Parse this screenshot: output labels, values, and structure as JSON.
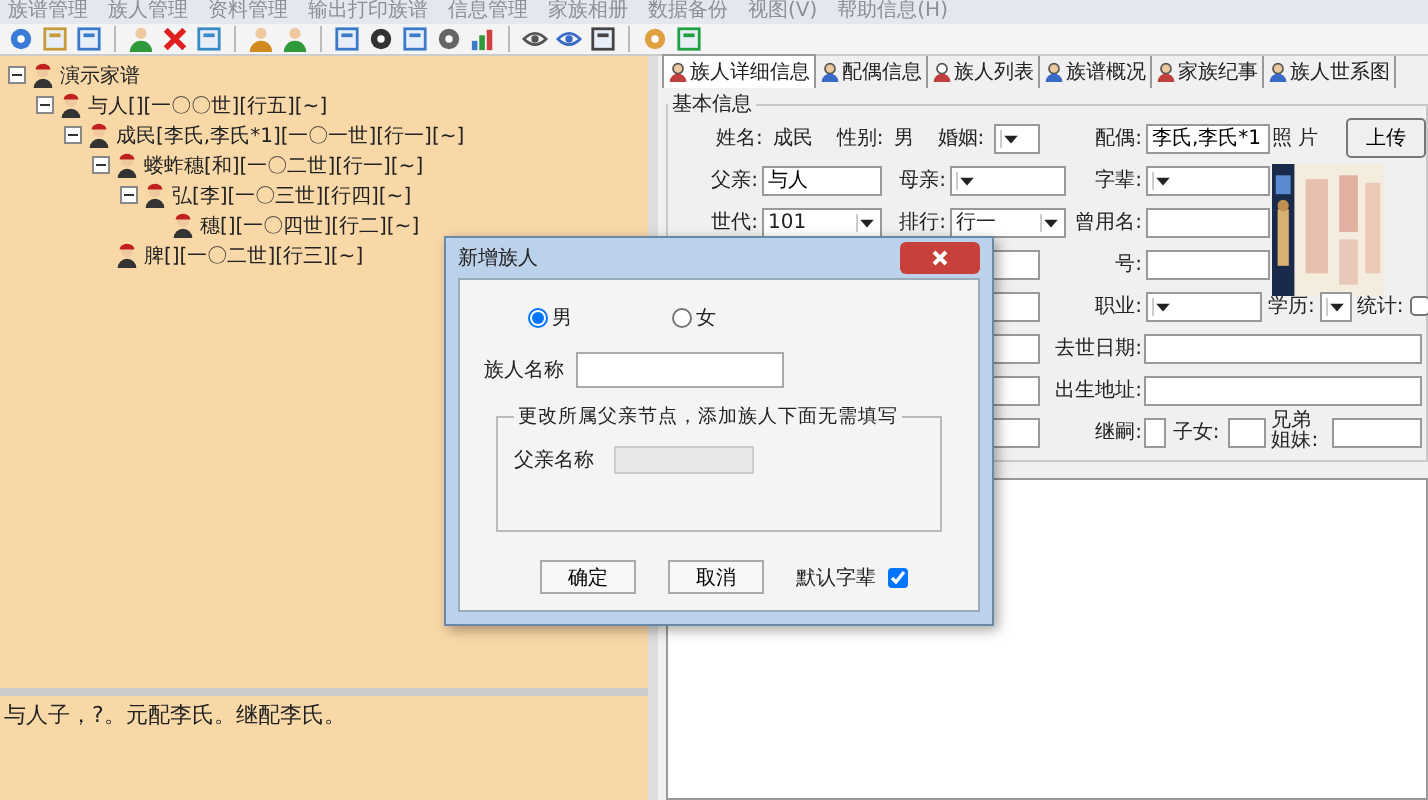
{
  "menu": [
    "族谱管理",
    "族人管理",
    "资料管理",
    "输出打印族谱",
    "信息管理",
    "家族相册",
    "数据备份",
    "视图(V)",
    "帮助信息(H)"
  ],
  "tree": [
    {
      "label": "演示家谱",
      "expanded": true,
      "children": [
        {
          "label": "与人[][一〇〇世][行五][~]",
          "expanded": true,
          "children": [
            {
              "label": "成民[李氏,李氏*1][一〇一世][行一][~]",
              "expanded": true,
              "children": [
                {
                  "label": "蝼蚱穗[和][一〇二世][行一][~]",
                  "expanded": true,
                  "children": [
                    {
                      "label": "弘[李][一〇三世][行四][~]",
                      "expanded": true,
                      "children": [
                        {
                          "label": "穗[][一〇四世][行二][~]"
                        }
                      ]
                    }
                  ]
                },
                {
                  "label": "脾[][一〇二世][行三][~]"
                }
              ]
            }
          ]
        }
      ]
    }
  ],
  "note": "与人子，?。元配李氏。继配李氏。",
  "tabs": [
    {
      "label": "族人详细信息",
      "selected": true
    },
    {
      "label": "配偶信息",
      "selected": false
    },
    {
      "label": "族人列表",
      "selected": false
    },
    {
      "label": "族谱概况",
      "selected": false
    },
    {
      "label": "家族纪事",
      "selected": false
    },
    {
      "label": "族人世系图",
      "selected": false
    }
  ],
  "detail": {
    "legend": "基本信息",
    "name": {
      "label": "姓名:",
      "value": "成民"
    },
    "sex": {
      "label": "性别:",
      "value": "男"
    },
    "marriage": {
      "label": "婚姻:"
    },
    "spouse": {
      "label": "配偶:",
      "value": "李氏,李氏*1"
    },
    "photo": {
      "label": "照 片",
      "upload": "上传"
    },
    "father": {
      "label": "父亲:",
      "value": "与人"
    },
    "mother": {
      "label": "母亲:"
    },
    "generation_name": {
      "label": "字辈:"
    },
    "generation": {
      "label": "世代:",
      "value": "101"
    },
    "rank": {
      "label": "排行:",
      "value": "行一"
    },
    "former_name": {
      "label": "曾用名:"
    },
    "alias": {
      "label": "号:"
    },
    "occupation": {
      "label": "职业:"
    },
    "education": {
      "label": "学历:"
    },
    "count": {
      "label": "统计:",
      "checked": false
    },
    "death_date": {
      "label": "去世日期:"
    },
    "birthplace": {
      "label": "出生地址:"
    },
    "heir": {
      "label": "继嗣:"
    },
    "children": {
      "label": "子女:"
    },
    "siblings": {
      "label": "兄弟姐妹:"
    }
  },
  "dialog": {
    "title": "新增族人",
    "radios": [
      {
        "label": "男",
        "selected": true
      },
      {
        "label": "女",
        "selected": false
      }
    ],
    "name_label": "族人名称",
    "group_title": "更改所属父亲节点，添加族人下面无需填写",
    "father_label": "父亲名称",
    "ok": "确定",
    "cancel": "取消",
    "default_generation": {
      "label": "默认字辈",
      "checked": true
    }
  }
}
